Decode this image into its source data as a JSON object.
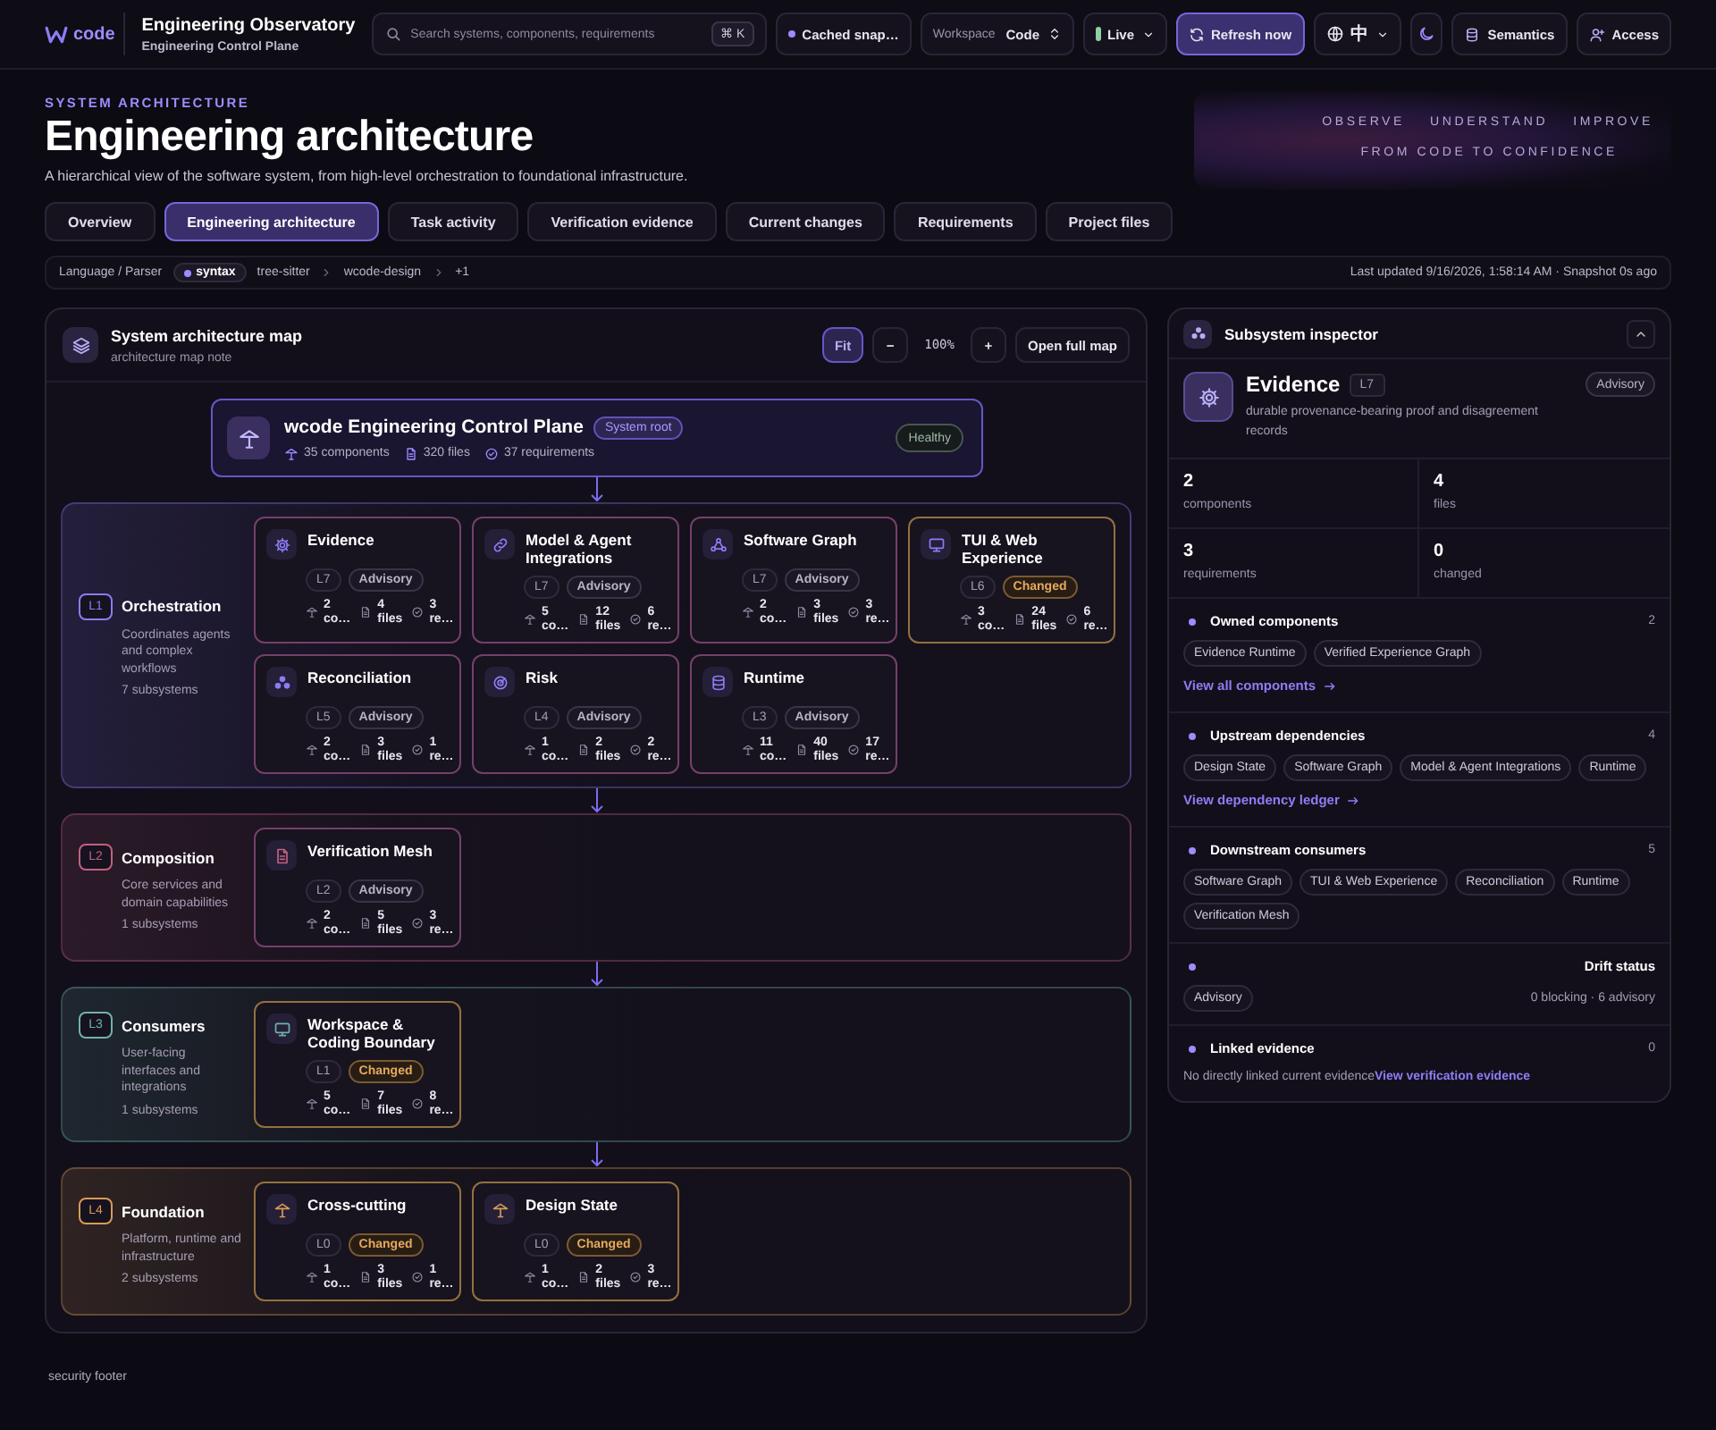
{
  "topbar": {
    "logo": "code",
    "title": "Engineering Observatory",
    "subtitle": "Engineering Control Plane",
    "search": {
      "placeholder": "Search systems, components, requirements",
      "shortcut": "⌘ K"
    },
    "snapshot": "Cached snap…",
    "workspace": {
      "label": "Workspace",
      "value": "Code"
    },
    "live": "Live",
    "refresh": "Refresh now",
    "language": "中",
    "semantics": "Semantics",
    "access": "Access"
  },
  "header": {
    "eyebrow": "SYSTEM ARCHITECTURE",
    "title": "Engineering architecture",
    "description": "A hierarchical view of the software system, from high-level orchestration to foundational infrastructure.",
    "hero": {
      "words": [
        "OBSERVE",
        "UNDERSTAND",
        "IMPROVE"
      ],
      "tagline": "FROM CODE TO CONFIDENCE"
    }
  },
  "tabs": [
    {
      "label": "Overview",
      "selected": false
    },
    {
      "label": "Engineering architecture",
      "selected": true
    },
    {
      "label": "Task activity",
      "selected": false
    },
    {
      "label": "Verification evidence",
      "selected": false
    },
    {
      "label": "Current changes",
      "selected": false
    },
    {
      "label": "Requirements",
      "selected": false
    },
    {
      "label": "Project files",
      "selected": false
    }
  ],
  "filter_bar": {
    "label": "Language / Parser",
    "chips": [
      {
        "label": "syntax",
        "kind": "active"
      },
      {
        "label": "tree-sitter",
        "kind": "tag"
      },
      {
        "label": "wcode-design",
        "kind": "path"
      },
      {
        "label": "+1",
        "kind": "path"
      }
    ],
    "updated": "Last updated 9/16/2026, 1:58:14 AM · Snapshot 0s ago"
  },
  "map": {
    "title": "System architecture map",
    "note": "architecture map note",
    "controls": {
      "fit": {
        "label": "Fit",
        "selected": true
      },
      "zoom_out": "−",
      "zoom": "100%",
      "zoom_in": "+",
      "open": "Open full map"
    },
    "root": {
      "name": "wcode Engineering Control Plane",
      "badge": "System root",
      "status": "Healthy",
      "stats": [
        {
          "kind": "components",
          "text": "35 components"
        },
        {
          "kind": "files",
          "text": "320 files"
        },
        {
          "kind": "requirements",
          "text": "37 requirements"
        }
      ]
    },
    "layers": [
      {
        "level": "L1",
        "name": "Orchestration",
        "description": "Coordinates agents and complex workflows",
        "count": "7 subsystems",
        "color": "#8b7cf6",
        "cards": [
          {
            "name": "Evidence",
            "level": "L7",
            "badge": {
              "label": "Advisory",
              "kind": "advisory"
            },
            "metrics": [
              {
                "kind": "components",
                "text": "2 co…"
              },
              {
                "kind": "files",
                "text": "4 files"
              },
              {
                "kind": "requirements",
                "text": "3 re…"
              }
            ]
          },
          {
            "name": "Model & Agent Integrations",
            "level": "L7",
            "badge": {
              "label": "Advisory",
              "kind": "advisory"
            },
            "metrics": [
              {
                "kind": "components",
                "text": "5 co…"
              },
              {
                "kind": "files",
                "text": "12 files"
              },
              {
                "kind": "requirements",
                "text": "6 re…"
              }
            ]
          },
          {
            "name": "Software Graph",
            "level": "L7",
            "badge": {
              "label": "Advisory",
              "kind": "advisory"
            },
            "metrics": [
              {
                "kind": "components",
                "text": "2 co…"
              },
              {
                "kind": "files",
                "text": "3 files"
              },
              {
                "kind": "requirements",
                "text": "3 re…"
              }
            ]
          },
          {
            "name": "TUI & Web Experience",
            "level": "L6",
            "badge": {
              "label": "Changed",
              "kind": "changed"
            },
            "metrics": [
              {
                "kind": "components",
                "text": "3 co…"
              },
              {
                "kind": "files",
                "text": "24 files"
              },
              {
                "kind": "requirements",
                "text": "6 re…"
              }
            ]
          },
          {
            "name": "Reconciliation",
            "level": "L5",
            "badge": {
              "label": "Advisory",
              "kind": "advisory"
            },
            "metrics": [
              {
                "kind": "components",
                "text": "2 co…"
              },
              {
                "kind": "files",
                "text": "3 files"
              },
              {
                "kind": "requirements",
                "text": "1 re…"
              }
            ]
          },
          {
            "name": "Risk",
            "level": "L4",
            "badge": {
              "label": "Advisory",
              "kind": "advisory"
            },
            "metrics": [
              {
                "kind": "components",
                "text": "1 co…"
              },
              {
                "kind": "files",
                "text": "2 files"
              },
              {
                "kind": "requirements",
                "text": "2 re…"
              }
            ]
          },
          {
            "name": "Runtime",
            "level": "L3",
            "badge": {
              "label": "Advisory",
              "kind": "advisory"
            },
            "metrics": [
              {
                "kind": "components",
                "text": "11 co…"
              },
              {
                "kind": "files",
                "text": "40 files"
              },
              {
                "kind": "requirements",
                "text": "17 re…"
              }
            ]
          }
        ]
      },
      {
        "level": "L2",
        "name": "Composition",
        "description": "Core services and domain capabilities",
        "count": "1 subsystems",
        "color": "#c2607f",
        "cards": [
          {
            "name": "Verification Mesh",
            "level": "L2",
            "badge": {
              "label": "Advisory",
              "kind": "advisory"
            },
            "metrics": [
              {
                "kind": "components",
                "text": "2 co…"
              },
              {
                "kind": "files",
                "text": "5 files"
              },
              {
                "kind": "requirements",
                "text": "3 re…"
              }
            ]
          }
        ]
      },
      {
        "level": "L3",
        "name": "Consumers",
        "description": "User-facing interfaces and integrations",
        "count": "1 subsystems",
        "color": "#6fb3a8",
        "cards": [
          {
            "name": "Workspace & Coding Boundary",
            "level": "L1",
            "badge": {
              "label": "Changed",
              "kind": "changed"
            },
            "metrics": [
              {
                "kind": "components",
                "text": "5 co…"
              },
              {
                "kind": "files",
                "text": "7 files"
              },
              {
                "kind": "requirements",
                "text": "8 re…"
              }
            ]
          }
        ]
      },
      {
        "level": "L4",
        "name": "Foundation",
        "description": "Platform, runtime and infrastructure",
        "count": "2 subsystems",
        "color": "#d89b55",
        "cards": [
          {
            "name": "Cross-cutting",
            "level": "L0",
            "badge": {
              "label": "Changed",
              "kind": "changed"
            },
            "metrics": [
              {
                "kind": "components",
                "text": "1 co…"
              },
              {
                "kind": "files",
                "text": "3 files"
              },
              {
                "kind": "requirements",
                "text": "1 re…"
              }
            ]
          },
          {
            "name": "Design State",
            "level": "L0",
            "badge": {
              "label": "Changed",
              "kind": "changed"
            },
            "metrics": [
              {
                "kind": "components",
                "text": "1 co…"
              },
              {
                "kind": "files",
                "text": "2 files"
              },
              {
                "kind": "requirements",
                "text": "3 re…"
              }
            ]
          }
        ]
      }
    ]
  },
  "inspector": {
    "title": "Subsystem inspector",
    "expanded": true,
    "subject": {
      "name": "Evidence",
      "level": "L7",
      "badge": {
        "label": "Advisory",
        "kind": "advisory"
      },
      "description": "durable provenance-bearing proof and disagreement records"
    },
    "stats": [
      {
        "value": "2",
        "label": "components"
      },
      {
        "value": "4",
        "label": "files"
      },
      {
        "value": "3",
        "label": "requirements"
      },
      {
        "value": "0",
        "label": "changed"
      }
    ],
    "sections": [
      {
        "kind": "list",
        "title": "Owned components",
        "count": "2",
        "chips": [
          "Evidence Runtime",
          "Verified Experience Graph"
        ],
        "link": "View all components"
      },
      {
        "kind": "list",
        "title": "Upstream dependencies",
        "count": "4",
        "chips": [
          "Design State",
          "Software Graph",
          "Model & Agent Integrations",
          "Runtime"
        ],
        "link": "View dependency ledger"
      },
      {
        "kind": "list",
        "title": "Downstream consumers",
        "count": "5",
        "chips": [
          "Software Graph",
          "TUI & Web Experience",
          "Reconciliation",
          "Runtime",
          "Verification Mesh"
        ]
      },
      {
        "kind": "drift",
        "title": "Drift status",
        "chips": [
          "Advisory"
        ],
        "summary": "0 blocking · 6 advisory"
      },
      {
        "kind": "linked",
        "title": "Linked evidence",
        "count": "0",
        "message": "No directly linked current evidence",
        "link": "View verification evidence"
      }
    ]
  },
  "footer": "security footer"
}
